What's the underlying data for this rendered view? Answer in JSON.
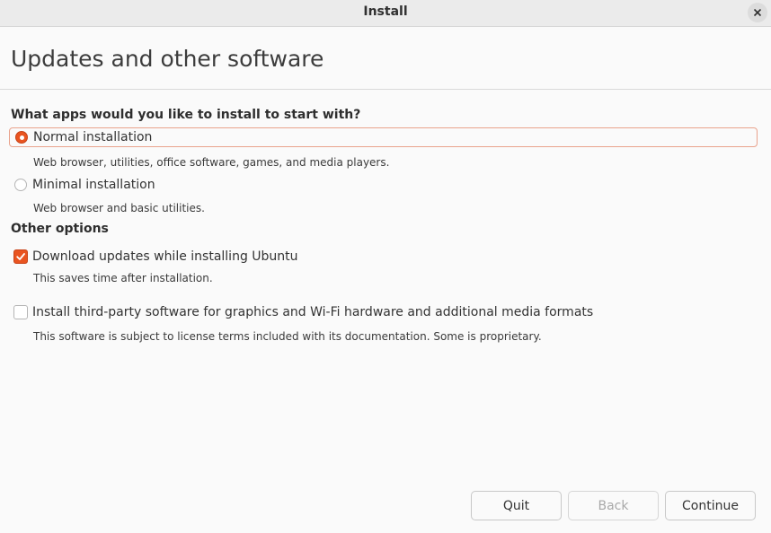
{
  "window": {
    "title": "Install"
  },
  "page": {
    "title": "Updates and other software"
  },
  "apps_section": {
    "heading": "What apps would you like to install to start with?",
    "options": [
      {
        "label": "Normal installation",
        "description": "Web browser, utilities, office software, games, and media players.",
        "selected": true
      },
      {
        "label": "Minimal installation",
        "description": "Web browser and basic utilities.",
        "selected": false
      }
    ]
  },
  "other_section": {
    "heading": "Other options",
    "options": [
      {
        "label": "Download updates while installing Ubuntu",
        "description": "This saves time after installation.",
        "checked": true
      },
      {
        "label": "Install third-party software for graphics and Wi-Fi hardware and additional media formats",
        "description": "This software is subject to license terms included with its documentation. Some is proprietary.",
        "checked": false
      }
    ]
  },
  "buttons": {
    "quit": "Quit",
    "back": "Back",
    "continue": "Continue"
  },
  "colors": {
    "accent": "#e95420",
    "focus_border": "#e9a38d",
    "background": "#fafafa",
    "titlebar": "#ebebeb"
  }
}
